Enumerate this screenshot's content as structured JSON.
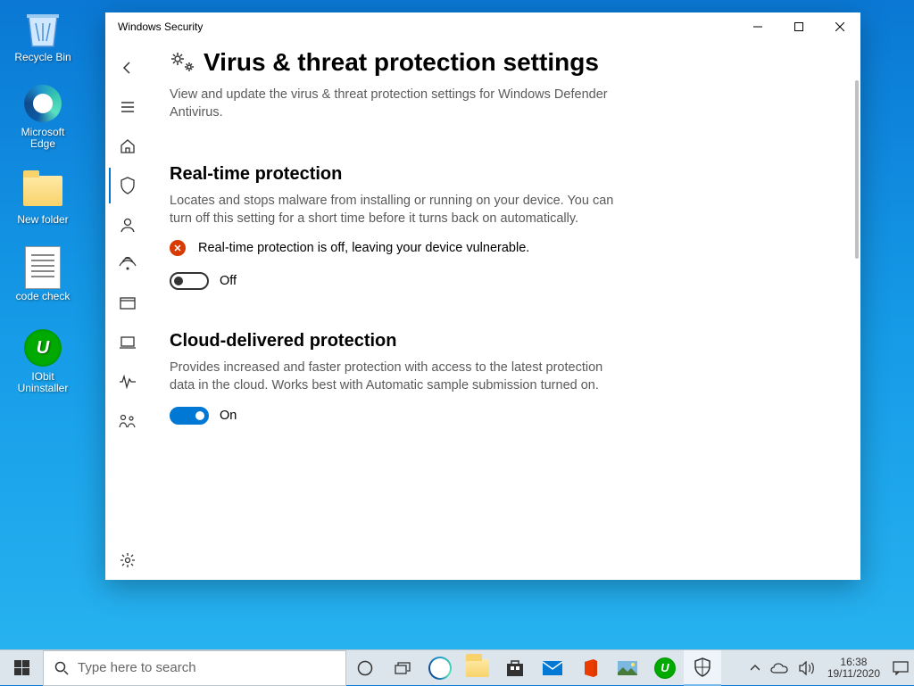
{
  "desktop": {
    "icons": [
      {
        "label": "Recycle Bin"
      },
      {
        "label": "Microsoft Edge"
      },
      {
        "label": "New folder"
      },
      {
        "label": "code check"
      },
      {
        "label": "IObit Uninstaller"
      }
    ]
  },
  "window": {
    "title": "Windows Security",
    "page": {
      "heading": "Virus & threat protection settings",
      "subtitle": "View and update the virus & threat protection settings for Windows Defender Antivirus."
    },
    "sections": {
      "rtp": {
        "heading": "Real-time protection",
        "desc": "Locates and stops malware from installing or running on your device. You can turn off this setting for a short time before it turns back on automatically.",
        "warning": "Real-time protection is off, leaving your device vulnerable.",
        "toggle_state": "Off"
      },
      "cloud": {
        "heading": "Cloud-delivered protection",
        "desc": "Provides increased and faster protection with access to the latest protection data in the cloud. Works best with Automatic sample submission turned on.",
        "toggle_state": "On"
      }
    }
  },
  "taskbar": {
    "search_placeholder": "Type here to search",
    "time": "16:38",
    "date": "19/11/2020"
  }
}
